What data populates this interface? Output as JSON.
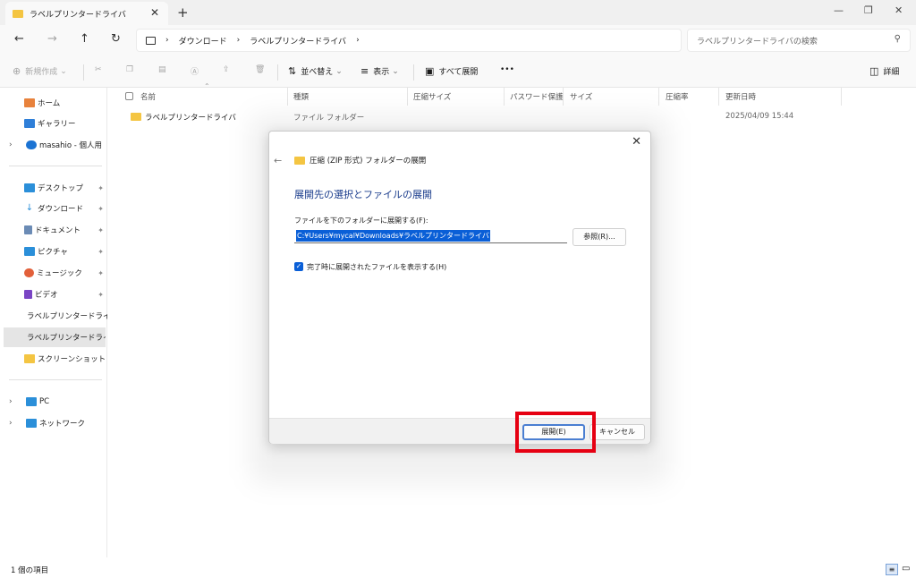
{
  "window": {
    "tab_title": "ラベルプリンタードライバ",
    "tab_close": "✕",
    "new_tab": "+",
    "minimize": "—",
    "maximize": "❐",
    "close": "✕"
  },
  "nav": {
    "back": "←",
    "forward": "→",
    "up": "↑",
    "refresh": "↻",
    "breadcrumb": [
      "ダウンロード",
      "ラベルプリンタードライバ"
    ],
    "search_placeholder": "ラベルプリンタードライバの検索"
  },
  "commandbar": {
    "new": "新規作成",
    "sort": "並べ替え",
    "view": "表示",
    "extract_all": "すべて展開",
    "more": "•••",
    "details": "詳細"
  },
  "sidebar": {
    "items": [
      {
        "label": "ホーム",
        "icon": "home-icon",
        "color": "#e8823c"
      },
      {
        "label": "ギャラリー",
        "icon": "gallery-icon",
        "color": "#2f7fd8"
      },
      {
        "label": "masahio - 個人用",
        "icon": "cloud-icon",
        "color": "#1b73d3"
      },
      {
        "label": "デスクトップ",
        "icon": "desktop-icon",
        "color": "#2b8fd9"
      },
      {
        "label": "ダウンロード",
        "icon": "download-icon",
        "color": "#2b8fd9"
      },
      {
        "label": "ドキュメント",
        "icon": "document-icon",
        "color": "#6b8bb5"
      },
      {
        "label": "ピクチャ",
        "icon": "picture-icon",
        "color": "#2b8fd9"
      },
      {
        "label": "ミュージック",
        "icon": "music-icon",
        "color": "#e2603a"
      },
      {
        "label": "ビデオ",
        "icon": "video-icon",
        "color": "#7a45c4"
      },
      {
        "label": "ラベルプリンタードライバ",
        "icon": "folder-icon",
        "color": "#f4c542"
      },
      {
        "label": "ラベルプリンタードライバ",
        "icon": "folder-icon",
        "color": "#f4c542"
      },
      {
        "label": "スクリーンショット",
        "icon": "folder-icon",
        "color": "#f4c542"
      },
      {
        "label": "PC",
        "icon": "pc-icon",
        "color": "#2b8fd9"
      },
      {
        "label": "ネットワーク",
        "icon": "network-icon",
        "color": "#2b8fd9"
      }
    ]
  },
  "filelist": {
    "columns": [
      "名前",
      "種類",
      "圧縮サイズ",
      "パスワード保護",
      "サイズ",
      "圧縮率",
      "更新日時"
    ],
    "rows": [
      {
        "name": "ラベルプリンタードライバ",
        "type": "ファイル フォルダー",
        "modified": "2025/04/09 15:44"
      }
    ]
  },
  "status": {
    "count": "1 個の項目"
  },
  "dialog": {
    "caption": "圧縮 (ZIP 形式) フォルダーの展開",
    "heading": "展開先の選択とファイルの展開",
    "folder_label": "ファイルを下のフォルダーに展開する(F):",
    "path_value": "C:¥Users¥mycal¥Downloads¥ラベルプリンタードライバ",
    "browse": "参照(R)...",
    "show_files_label": "完了時に展開されたファイルを表示する(H)",
    "show_files_checked": true,
    "extract_button": "展開(E)",
    "cancel_button": "キャンセル",
    "highlight_color": "#e60012"
  }
}
